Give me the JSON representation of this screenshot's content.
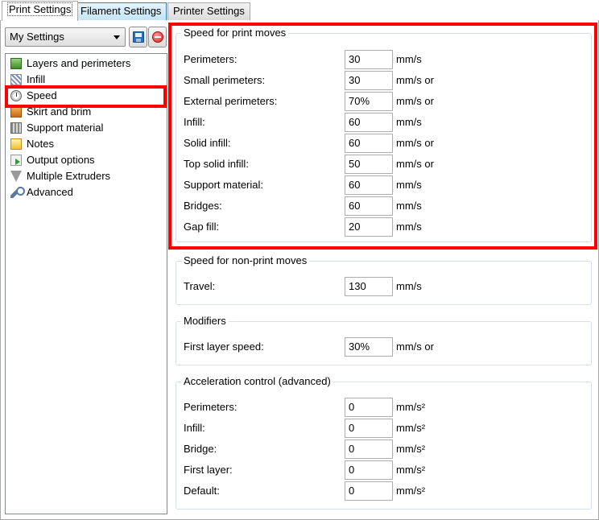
{
  "tabs": [
    {
      "label": "Print Settings",
      "active": true
    },
    {
      "label": "Filament Settings",
      "active": false
    },
    {
      "label": "Printer Settings",
      "active": false
    }
  ],
  "preset": {
    "selected": "My Settings"
  },
  "tree": [
    {
      "label": "Layers and perimeters",
      "icon": "layers-icon"
    },
    {
      "label": "Infill",
      "icon": "infill-icon"
    },
    {
      "label": "Speed",
      "icon": "speedometer-icon"
    },
    {
      "label": "Skirt and brim",
      "icon": "skirt-icon"
    },
    {
      "label": "Support material",
      "icon": "support-icon"
    },
    {
      "label": "Notes",
      "icon": "notes-icon"
    },
    {
      "label": "Output options",
      "icon": "output-icon"
    },
    {
      "label": "Multiple Extruders",
      "icon": "funnel-icon"
    },
    {
      "label": "Advanced",
      "icon": "wrench-icon"
    }
  ],
  "groups": {
    "print_moves": {
      "title": "Speed for print moves",
      "rows": [
        {
          "label": "Perimeters:",
          "value": "30",
          "unit": "mm/s"
        },
        {
          "label": "Small perimeters:",
          "value": "30",
          "unit": "mm/s or"
        },
        {
          "label": "External perimeters:",
          "value": "70%",
          "unit": "mm/s or"
        },
        {
          "label": "Infill:",
          "value": "60",
          "unit": "mm/s"
        },
        {
          "label": "Solid infill:",
          "value": "60",
          "unit": "mm/s or"
        },
        {
          "label": "Top solid infill:",
          "value": "50",
          "unit": "mm/s or"
        },
        {
          "label": "Support material:",
          "value": "60",
          "unit": "mm/s"
        },
        {
          "label": "Bridges:",
          "value": "60",
          "unit": "mm/s"
        },
        {
          "label": "Gap fill:",
          "value": "20",
          "unit": "mm/s"
        }
      ]
    },
    "non_print_moves": {
      "title": "Speed for non-print moves",
      "rows": [
        {
          "label": "Travel:",
          "value": "130",
          "unit": "mm/s"
        }
      ]
    },
    "modifiers": {
      "title": "Modifiers",
      "rows": [
        {
          "label": "First layer speed:",
          "value": "30%",
          "unit": "mm/s or"
        }
      ]
    },
    "acceleration": {
      "title": "Acceleration control (advanced)",
      "rows": [
        {
          "label": "Perimeters:",
          "value": "0",
          "unit": "mm/s²"
        },
        {
          "label": "Infill:",
          "value": "0",
          "unit": "mm/s²"
        },
        {
          "label": "Bridge:",
          "value": "0",
          "unit": "mm/s²"
        },
        {
          "label": "First layer:",
          "value": "0",
          "unit": "mm/s²"
        },
        {
          "label": "Default:",
          "value": "0",
          "unit": "mm/s²"
        }
      ]
    }
  },
  "colors": {
    "highlight": "#ff0000",
    "tab_hover": "#c4e5f6"
  }
}
